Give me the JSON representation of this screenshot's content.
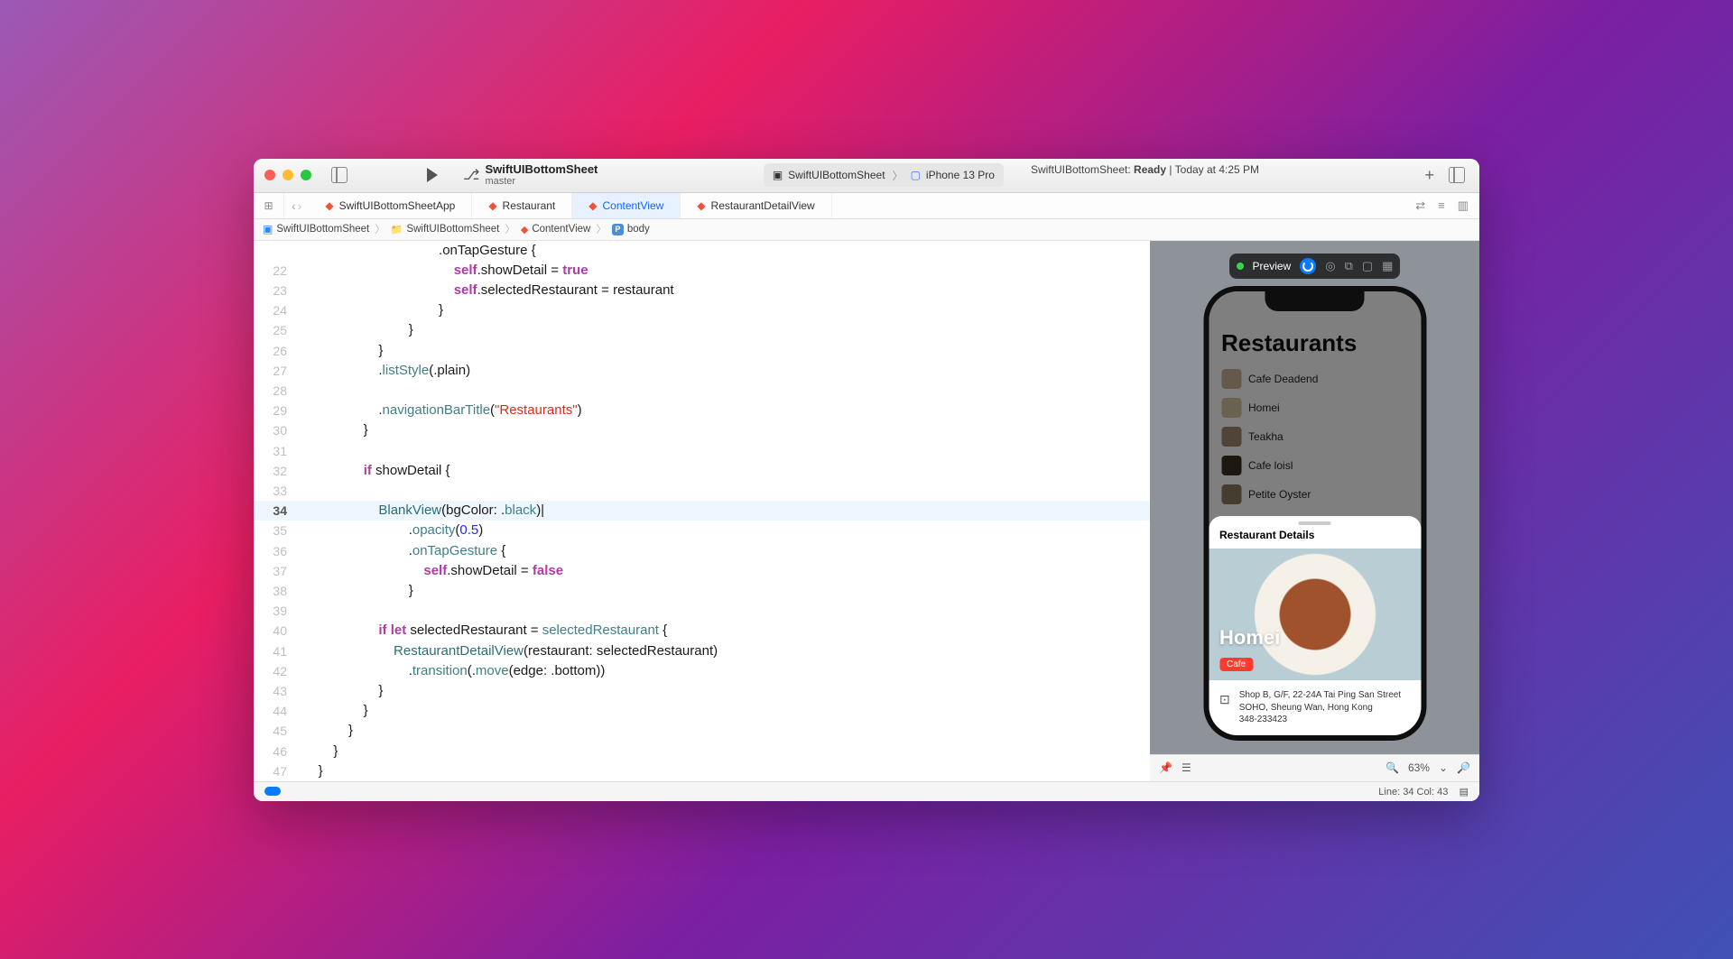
{
  "titlebar": {
    "project_name": "SwiftUIBottomSheet",
    "branch": "master",
    "scheme": "SwiftUIBottomSheet",
    "device": "iPhone 13 Pro",
    "status_prefix": "SwiftUIBottomSheet:",
    "status_ready": "Ready",
    "status_sep": "|",
    "status_time": "Today at 4:25 PM"
  },
  "tabs": [
    {
      "label": "SwiftUIBottomSheetApp"
    },
    {
      "label": "Restaurant"
    },
    {
      "label": "ContentView"
    },
    {
      "label": "RestaurantDetailView"
    }
  ],
  "breadcrumb": {
    "p1": "SwiftUIBottomSheet",
    "p2": "SwiftUIBottomSheet",
    "p3": "ContentView",
    "p4": "body"
  },
  "code": {
    "l22": {
      "a": "                                        ",
      "b": "self",
      "c": ".showDetail = ",
      "d": "true"
    },
    "l23": {
      "a": "                                        ",
      "b": "self",
      "c": ".selectedRestaurant = restaurant"
    },
    "l24": "                                    }",
    "l25": "                            }",
    "l26": "                    }",
    "l27": {
      "a": "                    .",
      "b": "listStyle",
      "c": "(.plain)"
    },
    "l28": "",
    "l29": {
      "a": "                    .",
      "b": "navigationBarTitle",
      "c": "(",
      "d": "\"Restaurants\"",
      "e": ")"
    },
    "l30": "                }",
    "l31": "",
    "l32": {
      "a": "                ",
      "b": "if",
      "c": " showDetail {"
    },
    "l33": "",
    "l34": {
      "a": "                    ",
      "b": "BlankView",
      "c": "(bgColor: .",
      "d": "black",
      "e": ")|"
    },
    "l35": {
      "a": "                            .",
      "b": "opacity",
      "c": "(",
      "d": "0.5",
      "e": ")"
    },
    "l36": {
      "a": "                            .",
      "b": "onTapGesture",
      "c": " {"
    },
    "l37": {
      "a": "                                ",
      "b": "self",
      "c": ".showDetail = ",
      "d": "false"
    },
    "l38": "                            }",
    "l39": "",
    "l40": {
      "a": "                    ",
      "b": "if let",
      "c": " selectedRestaurant = ",
      "d": "selectedRestaurant",
      "e": " {"
    },
    "l41": {
      "a": "                        ",
      "b": "RestaurantDetailView",
      "c": "(restaurant: selectedRestaurant)"
    },
    "l42": {
      "a": "                            .",
      "b": "transition",
      "c": "(.",
      "d": "move",
      "e": "(edge: .bottom))"
    },
    "l43": "                    }",
    "l44": "                }",
    "l45": "            }",
    "l46": "        }",
    "l47": "    }"
  },
  "preview": {
    "label": "Preview",
    "list_title": "Restaurants",
    "restaurants": [
      "Cafe Deadend",
      "Homei",
      "Teakha",
      "Cafe loisl",
      "Petite Oyster"
    ],
    "sheet": {
      "header": "Restaurant Details",
      "title": "Homei",
      "badge": "Cafe",
      "address_l1": "Shop B, G/F, 22-24A Tai Ping San Street",
      "address_l2": "SOHO, Sheung Wan, Hong Kong",
      "phone": "348-233423"
    },
    "zoom": "63%"
  },
  "statusbar": {
    "cursor": "Line: 34  Col: 43"
  }
}
